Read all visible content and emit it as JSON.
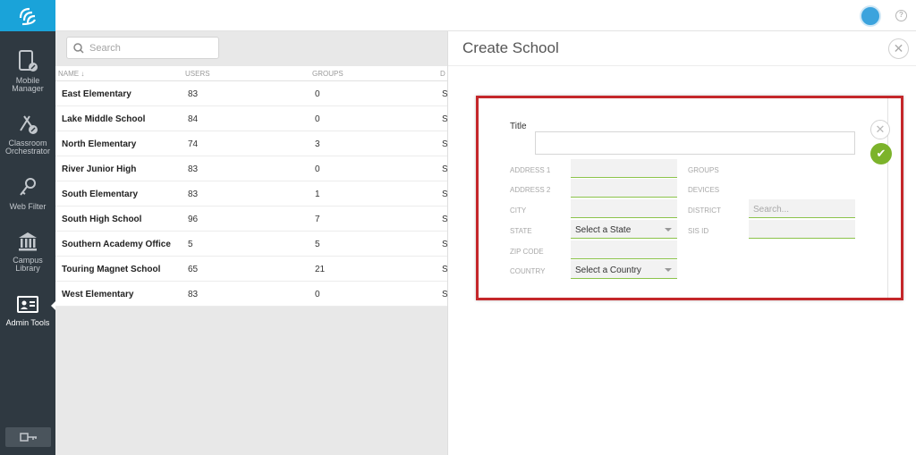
{
  "nav": {
    "items": [
      {
        "label1": "Mobile",
        "label2": "Manager"
      },
      {
        "label1": "Classroom",
        "label2": "Orchestrator"
      },
      {
        "label1": "Web Filter",
        "label2": ""
      },
      {
        "label1": "Campus",
        "label2": "Library"
      },
      {
        "label1": "Admin Tools",
        "label2": ""
      }
    ],
    "active_index": 4
  },
  "search": {
    "placeholder": "Search"
  },
  "table": {
    "columns": [
      "NAME",
      "USERS",
      "GROUPS",
      "D"
    ],
    "sort_column": "NAME",
    "rows": [
      {
        "name": "East Elementary",
        "users": "83",
        "groups": "0",
        "d": "S"
      },
      {
        "name": "Lake Middle School",
        "users": "84",
        "groups": "0",
        "d": "S"
      },
      {
        "name": "North Elementary",
        "users": "74",
        "groups": "3",
        "d": "S"
      },
      {
        "name": "River Junior High",
        "users": "83",
        "groups": "0",
        "d": "S"
      },
      {
        "name": "South Elementary",
        "users": "83",
        "groups": "1",
        "d": "S"
      },
      {
        "name": "South High School",
        "users": "96",
        "groups": "7",
        "d": "S"
      },
      {
        "name": "Southern Academy Office",
        "users": "5",
        "groups": "5",
        "d": "S"
      },
      {
        "name": "Touring Magnet School",
        "users": "65",
        "groups": "21",
        "d": "S"
      },
      {
        "name": "West Elementary",
        "users": "83",
        "groups": "0",
        "d": "S"
      }
    ]
  },
  "panel": {
    "title": "Create School",
    "form": {
      "title_label": "Title",
      "title_value": "",
      "address1_label": "ADDRESS 1",
      "address2_label": "ADDRESS 2",
      "city_label": "CITY",
      "state_label": "STATE",
      "state_value": "Select a State",
      "zip_label": "ZIP CODE",
      "country_label": "COUNTRY",
      "country_value": "Select a Country",
      "groups_label": "GROUPS",
      "devices_label": "DEVICES",
      "district_label": "DISTRICT",
      "district_placeholder": "Search...",
      "sisid_label": "SIS ID"
    }
  },
  "colors": {
    "accent": "#1aa3d9",
    "sidebar": "#2f3941",
    "confirm": "#7cb32b",
    "highlight_border": "#c4272a"
  }
}
